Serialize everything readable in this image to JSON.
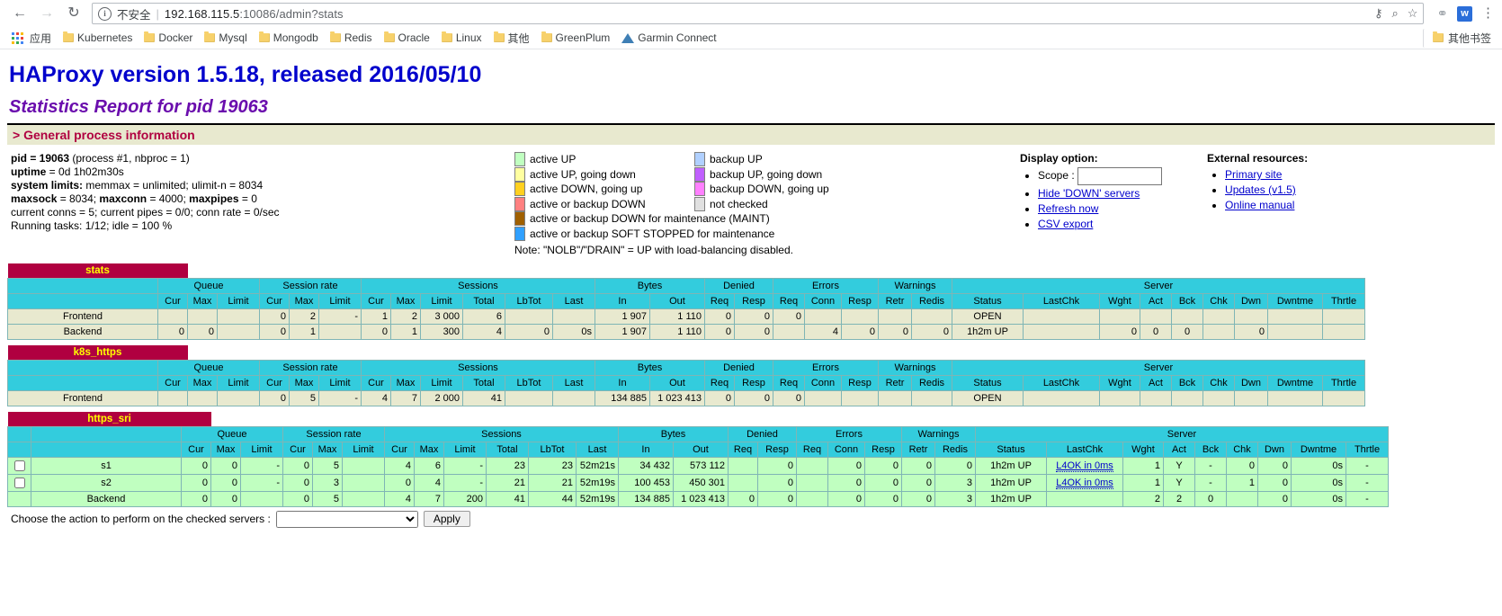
{
  "browser": {
    "back_icon": "back-arrow-icon",
    "forward_icon": "forward-arrow-icon",
    "reload_icon": "reload-icon",
    "security_label": "不安全",
    "url_host": "192.168.115.5",
    "url_rest": ":10086/admin?stats",
    "bookmarks": [
      {
        "label": "应用",
        "icon": "apps-grid-icon"
      },
      {
        "label": "Kubernetes",
        "icon": "folder-icon"
      },
      {
        "label": "Docker",
        "icon": "folder-icon"
      },
      {
        "label": "Mysql",
        "icon": "folder-icon"
      },
      {
        "label": "Mongodb",
        "icon": "folder-icon"
      },
      {
        "label": "Redis",
        "icon": "folder-icon"
      },
      {
        "label": "Oracle",
        "icon": "folder-icon"
      },
      {
        "label": "Linux",
        "icon": "folder-icon"
      },
      {
        "label": "其他",
        "icon": "folder-icon"
      },
      {
        "label": "GreenPlum",
        "icon": "folder-icon"
      },
      {
        "label": "Garmin Connect",
        "icon": "triangle-icon"
      }
    ],
    "other_bookmarks": "其他书签"
  },
  "header": {
    "title": "HAProxy version 1.5.18, released 2016/05/10",
    "subtitle": "Statistics Report for pid 19063",
    "section": "> General process information"
  },
  "process": {
    "pid_label": "pid = 19063",
    "pid_rest": " (process #1, nbproc = 1)",
    "uptime_label": "uptime",
    "uptime_value": " = 0d 1h02m30s",
    "limits_label": "system limits:",
    "limits_value": " memmax = unlimited; ulimit-n = 8034",
    "maxsock_label": "maxsock",
    "maxsock_value": " = 8034; ",
    "maxconn_label": "maxconn",
    "maxconn_value": " = 4000; ",
    "maxpipes_label": "maxpipes",
    "maxpipes_value": " = 0",
    "conns": "current conns = 5; current pipes = 0/0; conn rate = 0/sec",
    "tasks": "Running tasks: 1/12; idle = 100 %"
  },
  "legend": {
    "left": [
      {
        "label": "active UP",
        "color": "#c0ffc0"
      },
      {
        "label": "active UP, going down",
        "color": "#ffffa0"
      },
      {
        "label": "active DOWN, going up",
        "color": "#ffd020"
      },
      {
        "label": "active or backup DOWN",
        "color": "#ff8080"
      },
      {
        "label": "active or backup DOWN for maintenance (MAINT)",
        "color": "#a06000"
      },
      {
        "label": "active or backup SOFT STOPPED for maintenance",
        "color": "#30a0ff"
      }
    ],
    "right": [
      {
        "label": "backup UP",
        "color": "#b0d0ff"
      },
      {
        "label": "backup UP, going down",
        "color": "#c060ff"
      },
      {
        "label": "backup DOWN, going up",
        "color": "#ff80ff"
      },
      {
        "label": "not checked",
        "color": "#e0e0e0"
      }
    ],
    "note": "Note: \"NOLB\"/\"DRAIN\" = UP with load-balancing disabled."
  },
  "display_option": {
    "title": "Display option:",
    "scope_label": "Scope :",
    "scope_value": "",
    "links": [
      "Hide 'DOWN' servers",
      "Refresh now",
      "CSV export"
    ]
  },
  "external_resources": {
    "title": "External resources:",
    "links": [
      "Primary site",
      "Updates (v1.5)",
      "Online manual"
    ]
  },
  "columns": {
    "groups": [
      "Queue",
      "Session rate",
      "Sessions",
      "Bytes",
      "Denied",
      "Errors",
      "Warnings",
      "Server"
    ],
    "queue": [
      "Cur",
      "Max",
      "Limit"
    ],
    "session_rate": [
      "Cur",
      "Max",
      "Limit"
    ],
    "sessions": [
      "Cur",
      "Max",
      "Limit",
      "Total",
      "LbTot",
      "Last"
    ],
    "bytes": [
      "In",
      "Out"
    ],
    "denied": [
      "Req",
      "Resp"
    ],
    "errors": [
      "Req",
      "Conn",
      "Resp"
    ],
    "warnings": [
      "Retr",
      "Redis"
    ],
    "server": [
      "Status",
      "LastChk",
      "Wght",
      "Act",
      "Bck",
      "Chk",
      "Dwn",
      "Dwntme",
      "Thrtle"
    ]
  },
  "proxies": [
    {
      "name": "stats",
      "has_checkbox": false,
      "rows": [
        {
          "name": "Frontend",
          "cells": [
            "",
            "",
            "",
            "0",
            "2",
            "-",
            "1",
            "2",
            "3 000",
            "6",
            "",
            "",
            "1 907",
            "1 110",
            "0",
            "0",
            "0",
            "",
            "",
            "",
            "",
            "OPEN",
            "",
            "",
            "",
            "",
            "",
            "",
            "",
            ""
          ]
        },
        {
          "name": "Backend",
          "cells": [
            "0",
            "0",
            "",
            "0",
            "1",
            "",
            "0",
            "1",
            "300",
            "4",
            "0",
            "0s",
            "1 907",
            "1 110",
            "0",
            "0",
            "",
            "4",
            "0",
            "0",
            "0",
            "1h2m UP",
            "",
            "0",
            "0",
            "0",
            "",
            "0",
            "",
            ""
          ]
        }
      ]
    },
    {
      "name": "k8s_https",
      "has_checkbox": false,
      "rows": [
        {
          "name": "Frontend",
          "cells": [
            "",
            "",
            "",
            "0",
            "5",
            "-",
            "4",
            "7",
            "2 000",
            "41",
            "",
            "",
            "134 885",
            "1 023 413",
            "0",
            "0",
            "0",
            "",
            "",
            "",
            "",
            "OPEN",
            "",
            "",
            "",
            "",
            "",
            "",
            "",
            ""
          ]
        }
      ]
    },
    {
      "name": "https_sri",
      "has_checkbox": true,
      "rows": [
        {
          "name": "s1",
          "checked": false,
          "cells": [
            "0",
            "0",
            "-",
            "0",
            "5",
            "",
            "4",
            "6",
            "-",
            "23",
            "23",
            "52m21s",
            "34 432",
            "573 112",
            "",
            "0",
            "",
            "0",
            "0",
            "0",
            "0",
            "1h2m UP",
            "L4OK in 0ms",
            "1",
            "Y",
            "-",
            "0",
            "0",
            "0s",
            "-"
          ]
        },
        {
          "name": "s2",
          "checked": false,
          "cells": [
            "0",
            "0",
            "-",
            "0",
            "3",
            "",
            "0",
            "4",
            "-",
            "21",
            "21",
            "52m19s",
            "100 453",
            "450 301",
            "",
            "0",
            "",
            "0",
            "0",
            "0",
            "3",
            "1h2m UP",
            "L4OK in 0ms",
            "1",
            "Y",
            "-",
            "1",
            "0",
            "0s",
            "-"
          ]
        },
        {
          "name": "Backend",
          "cells": [
            "0",
            "0",
            "",
            "0",
            "5",
            "",
            "4",
            "7",
            "200",
            "41",
            "44",
            "52m19s",
            "134 885",
            "1 023 413",
            "0",
            "0",
            "",
            "0",
            "0",
            "0",
            "3",
            "1h2m UP",
            "",
            "2",
            "2",
            "0",
            "",
            "0",
            "0s",
            "-"
          ]
        }
      ]
    }
  ],
  "action": {
    "label": "Choose the action to perform on the checked servers :",
    "selected": "",
    "apply": "Apply"
  }
}
